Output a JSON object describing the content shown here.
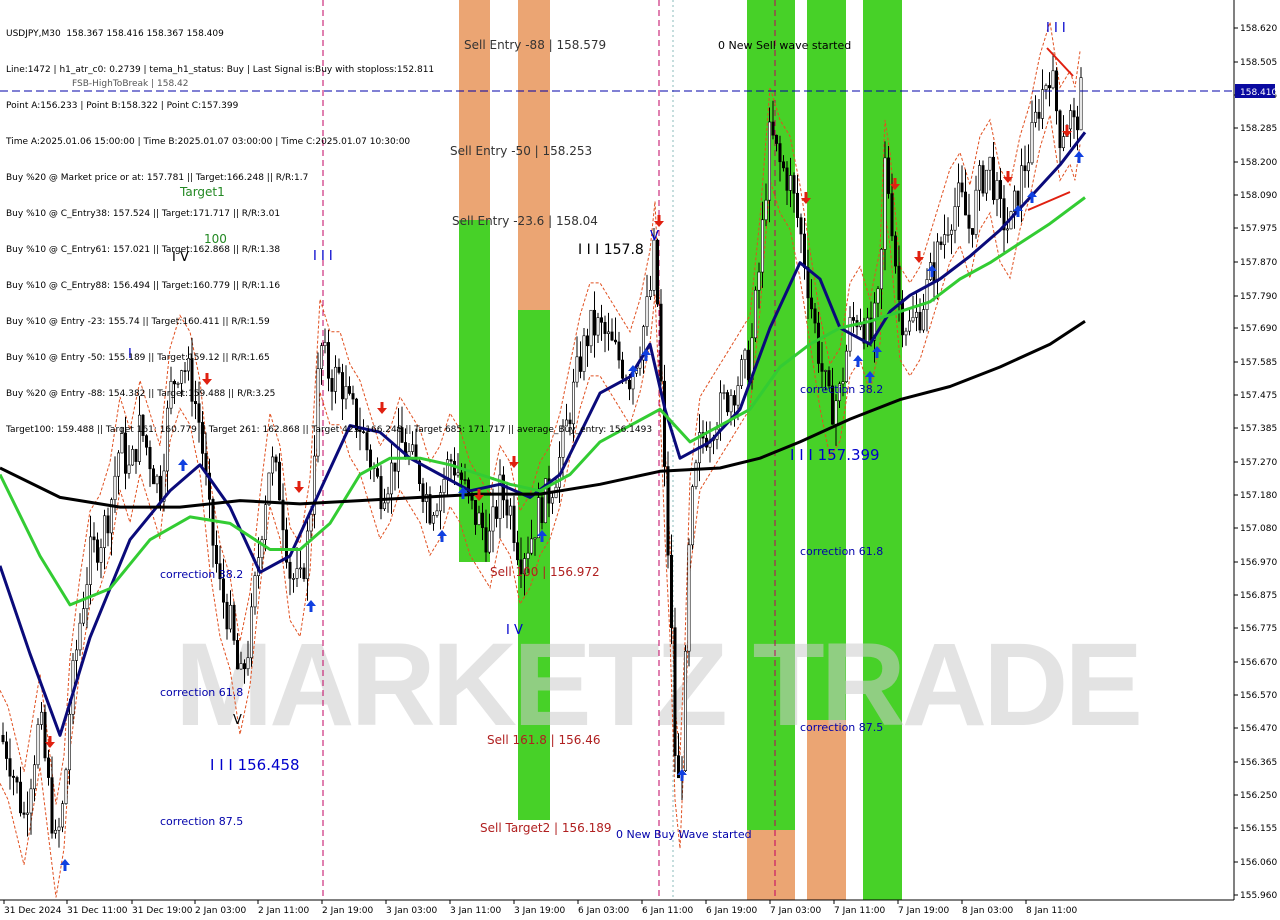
{
  "header": {
    "symbol_line": "USDJPY,M30  158.367 158.416 158.367 158.409",
    "lines": [
      "Line:1472 | h1_atr_c0: 0.2739 | tema_h1_status: Buy | Last Signal is:Buy with stoploss:152.811",
      "Point A:156.233 | Point B:158.322 | Point C:157.399",
      "Time A:2025.01.06 15:00:00 | Time B:2025.01.07 03:00:00 | Time C:2025.01.07 10:30:00",
      "Buy %20 @ Market price or at: 157.781 || Target:166.248 || R/R:1.7",
      "Buy %10 @ C_Entry38: 157.524 || Target:171.717 || R/R:3.01",
      "Buy %10 @ C_Entry61: 157.021 || Target:162.868 || R/R:1.38",
      "Buy %10 @ C_Entry88: 156.494 || Target:160.779 || R/R:1.16",
      "Buy %10 @ Entry -23: 155.74 || Target:160.411 || R/R:1.59",
      "Buy %10 @ Entry -50: 155.189 || Target:159.12 || R/R:1.65",
      "Buy %20 @ Entry -88: 154.382 || Target:159.488 || R/R:3.25",
      "Target100: 159.488 || Target 161: 160.779 || Target 261: 162.868 || Target 423: 166.248 || Target 685: 171.717 || average_Buy_entry: 156.1493"
    ],
    "overlap_label": "FSB-HighToBreak | 158.42"
  },
  "price_tag": "158.410",
  "watermark": "MARKETZ TRADE",
  "colors": {
    "background": "#ffffff",
    "candles": "#000000",
    "tema_blue": "#0a0a7a",
    "green_ma": "#33cc33",
    "black_ma": "#000000",
    "orange_band": "#e05020",
    "zone_green": "#33cc11",
    "zone_orange": "#e8955a",
    "buy_arrow": "#1040e0",
    "sell_arrow": "#e02010",
    "price_line": "#0000aa",
    "vline_magenta": "#c00060"
  },
  "annotations": {
    "sell_entry_88": "Sell Entry -88 | 158.579",
    "sell_entry_50": "Sell Entry -50 | 158.253",
    "sell_entry_236": "Sell Entry -23.6 | 158.04",
    "sell_100": "Sell 100 | 156.972",
    "sell_1618": "Sell 161.8 | 156.46",
    "sell_target2": "Sell Target2 | 156.189",
    "new_sell_wave": "0 New Sell wave started",
    "new_buy_wave": "0 New Buy Wave started",
    "target1": "Target1",
    "label_100": "100",
    "wave_iv_left": "I V",
    "wave_iii_top_left": "I I I",
    "wave_iii_1578": "I I I 157.8",
    "wave_iv_mid": "I V",
    "wave_v": "V",
    "wave_i": "I",
    "wave_iii_156458": "I I I 156.458",
    "wave_iii_157399": "I I I 157.399",
    "wave_iii_right": "I I I",
    "corr_382_left": "correction 38.2",
    "corr_618_left": "correction 61.8",
    "corr_875_left": "correction 87.5",
    "corr_382_right": "correction 38.2",
    "corr_618_right": "correction 61.8",
    "corr_875_right": "correction 87.5"
  },
  "chart_data": {
    "type": "candlestick",
    "symbol": "USDJPY",
    "timeframe": "M30",
    "ylim": [
      155.96,
      158.65
    ],
    "y_ticks": [
      "158.620",
      "158.505",
      "158.395",
      "158.285",
      "158.200",
      "158.090",
      "157.975",
      "157.870",
      "157.790",
      "157.690",
      "157.585",
      "157.475",
      "157.385",
      "157.270",
      "157.180",
      "157.080",
      "156.970",
      "156.875",
      "156.775",
      "156.670",
      "156.570",
      "156.470",
      "156.365",
      "156.250",
      "156.155",
      "156.060",
      "155.960"
    ],
    "x_ticks": [
      "31 Dec 2024",
      "31 Dec 11:00",
      "31 Dec 19:00",
      "2 Jan 03:00",
      "2 Jan 11:00",
      "2 Jan 19:00",
      "3 Jan 03:00",
      "3 Jan 11:00",
      "3 Jan 19:00",
      "6 Jan 03:00",
      "6 Jan 11:00",
      "6 Jan 19:00",
      "7 Jan 03:00",
      "7 Jan 11:00",
      "7 Jan 19:00",
      "8 Jan 03:00",
      "8 Jan 11:00"
    ],
    "current_price": 158.41,
    "close_path": [
      [
        0,
        156.45
      ],
      [
        8,
        156.4
      ],
      [
        16,
        156.3
      ],
      [
        24,
        156.2
      ],
      [
        32,
        156.35
      ],
      [
        40,
        156.5
      ],
      [
        48,
        156.3
      ],
      [
        56,
        156.1
      ],
      [
        64,
        156.25
      ],
      [
        70,
        156.55
      ],
      [
        80,
        156.8
      ],
      [
        90,
        157.0
      ],
      [
        100,
        157.05
      ],
      [
        110,
        157.15
      ],
      [
        120,
        157.35
      ],
      [
        130,
        157.25
      ],
      [
        140,
        157.4
      ],
      [
        150,
        157.3
      ],
      [
        160,
        157.2
      ],
      [
        170,
        157.5
      ],
      [
        180,
        157.6
      ],
      [
        190,
        157.55
      ],
      [
        200,
        157.4
      ],
      [
        210,
        157.1
      ],
      [
        220,
        156.9
      ],
      [
        230,
        156.8
      ],
      [
        240,
        156.6
      ],
      [
        250,
        156.75
      ],
      [
        260,
        157.05
      ],
      [
        270,
        157.3
      ],
      [
        280,
        157.2
      ],
      [
        290,
        156.95
      ],
      [
        300,
        156.9
      ],
      [
        310,
        157.1
      ],
      [
        320,
        157.65
      ],
      [
        330,
        157.55
      ],
      [
        340,
        157.55
      ],
      [
        350,
        157.45
      ],
      [
        360,
        157.4
      ],
      [
        370,
        157.3
      ],
      [
        380,
        157.2
      ],
      [
        390,
        157.25
      ],
      [
        400,
        157.35
      ],
      [
        410,
        157.3
      ],
      [
        420,
        157.25
      ],
      [
        430,
        157.15
      ],
      [
        440,
        157.2
      ],
      [
        450,
        157.3
      ],
      [
        460,
        157.25
      ],
      [
        470,
        157.15
      ],
      [
        480,
        157.1
      ],
      [
        490,
        157.05
      ],
      [
        500,
        157.2
      ],
      [
        510,
        157.15
      ],
      [
        520,
        157.0
      ],
      [
        530,
        157.05
      ],
      [
        540,
        157.15
      ],
      [
        550,
        157.2
      ],
      [
        560,
        157.3
      ],
      [
        570,
        157.45
      ],
      [
        580,
        157.6
      ],
      [
        590,
        157.7
      ],
      [
        600,
        157.7
      ],
      [
        610,
        157.65
      ],
      [
        620,
        157.6
      ],
      [
        630,
        157.55
      ],
      [
        640,
        157.65
      ],
      [
        650,
        157.8
      ],
      [
        655,
        157.95
      ],
      [
        660,
        157.6
      ],
      [
        665,
        157.2
      ],
      [
        670,
        156.9
      ],
      [
        675,
        156.4
      ],
      [
        680,
        156.25
      ],
      [
        685,
        156.6
      ],
      [
        690,
        157.1
      ],
      [
        700,
        157.35
      ],
      [
        710,
        157.4
      ],
      [
        720,
        157.45
      ],
      [
        730,
        157.5
      ],
      [
        740,
        157.55
      ],
      [
        750,
        157.6
      ],
      [
        760,
        157.9
      ],
      [
        770,
        158.3
      ],
      [
        780,
        158.2
      ],
      [
        790,
        158.15
      ],
      [
        800,
        158.0
      ],
      [
        810,
        157.8
      ],
      [
        820,
        157.6
      ],
      [
        830,
        157.45
      ],
      [
        840,
        157.5
      ],
      [
        850,
        157.7
      ],
      [
        860,
        157.75
      ],
      [
        870,
        157.65
      ],
      [
        880,
        157.8
      ],
      [
        885,
        158.2
      ],
      [
        890,
        158.1
      ],
      [
        900,
        157.75
      ],
      [
        910,
        157.7
      ],
      [
        920,
        157.75
      ],
      [
        930,
        157.85
      ],
      [
        940,
        157.95
      ],
      [
        950,
        158.05
      ],
      [
        960,
        158.1
      ],
      [
        970,
        158.0
      ],
      [
        980,
        158.15
      ],
      [
        990,
        158.2
      ],
      [
        1000,
        158.05
      ],
      [
        1010,
        158.0
      ],
      [
        1020,
        158.15
      ],
      [
        1030,
        158.25
      ],
      [
        1040,
        158.4
      ],
      [
        1050,
        158.5
      ],
      [
        1060,
        158.3
      ],
      [
        1070,
        158.35
      ],
      [
        1075,
        158.3
      ],
      [
        1080,
        158.41
      ]
    ],
    "series": [
      {
        "name": "tema",
        "path": [
          [
            0,
            156.97
          ],
          [
            30,
            156.7
          ],
          [
            60,
            156.45
          ],
          [
            90,
            156.75
          ],
          [
            130,
            157.05
          ],
          [
            170,
            157.2
          ],
          [
            200,
            157.28
          ],
          [
            230,
            157.15
          ],
          [
            260,
            156.95
          ],
          [
            290,
            157.0
          ],
          [
            320,
            157.2
          ],
          [
            350,
            157.4
          ],
          [
            380,
            157.38
          ],
          [
            410,
            157.3
          ],
          [
            440,
            157.25
          ],
          [
            470,
            157.2
          ],
          [
            500,
            157.22
          ],
          [
            530,
            157.18
          ],
          [
            560,
            157.25
          ],
          [
            600,
            157.5
          ],
          [
            630,
            157.55
          ],
          [
            650,
            157.65
          ],
          [
            665,
            157.45
          ],
          [
            680,
            157.3
          ],
          [
            710,
            157.35
          ],
          [
            740,
            157.45
          ],
          [
            770,
            157.7
          ],
          [
            800,
            157.9
          ],
          [
            820,
            157.85
          ],
          [
            840,
            157.7
          ],
          [
            870,
            157.65
          ],
          [
            890,
            157.75
          ],
          [
            910,
            157.8
          ],
          [
            940,
            157.85
          ],
          [
            970,
            157.92
          ],
          [
            1000,
            158.0
          ],
          [
            1030,
            158.1
          ],
          [
            1060,
            158.2
          ],
          [
            1085,
            158.3
          ]
        ]
      },
      {
        "name": "green",
        "path": [
          [
            0,
            157.25
          ],
          [
            40,
            157.0
          ],
          [
            70,
            156.85
          ],
          [
            110,
            156.9
          ],
          [
            150,
            157.05
          ],
          [
            190,
            157.12
          ],
          [
            230,
            157.1
          ],
          [
            270,
            157.02
          ],
          [
            300,
            157.02
          ],
          [
            330,
            157.1
          ],
          [
            360,
            157.25
          ],
          [
            390,
            157.3
          ],
          [
            420,
            157.3
          ],
          [
            450,
            157.28
          ],
          [
            480,
            157.25
          ],
          [
            510,
            157.22
          ],
          [
            540,
            157.2
          ],
          [
            570,
            157.25
          ],
          [
            600,
            157.35
          ],
          [
            630,
            157.4
          ],
          [
            660,
            157.45
          ],
          [
            690,
            157.35
          ],
          [
            720,
            157.4
          ],
          [
            750,
            157.45
          ],
          [
            780,
            157.58
          ],
          [
            810,
            157.65
          ],
          [
            840,
            157.7
          ],
          [
            870,
            157.72
          ],
          [
            900,
            157.75
          ],
          [
            930,
            157.78
          ],
          [
            960,
            157.85
          ],
          [
            990,
            157.9
          ],
          [
            1020,
            157.96
          ],
          [
            1050,
            158.02
          ],
          [
            1085,
            158.1
          ]
        ]
      },
      {
        "name": "black",
        "path": [
          [
            0,
            157.27
          ],
          [
            60,
            157.18
          ],
          [
            120,
            157.15
          ],
          [
            180,
            157.15
          ],
          [
            240,
            157.17
          ],
          [
            300,
            157.16
          ],
          [
            360,
            157.17
          ],
          [
            420,
            157.18
          ],
          [
            480,
            157.19
          ],
          [
            540,
            157.19
          ],
          [
            600,
            157.22
          ],
          [
            660,
            157.26
          ],
          [
            720,
            157.27
          ],
          [
            760,
            157.3
          ],
          [
            800,
            157.35
          ],
          [
            850,
            157.42
          ],
          [
            900,
            157.48
          ],
          [
            950,
            157.52
          ],
          [
            1000,
            157.58
          ],
          [
            1050,
            157.65
          ],
          [
            1085,
            157.72
          ]
        ]
      }
    ]
  }
}
